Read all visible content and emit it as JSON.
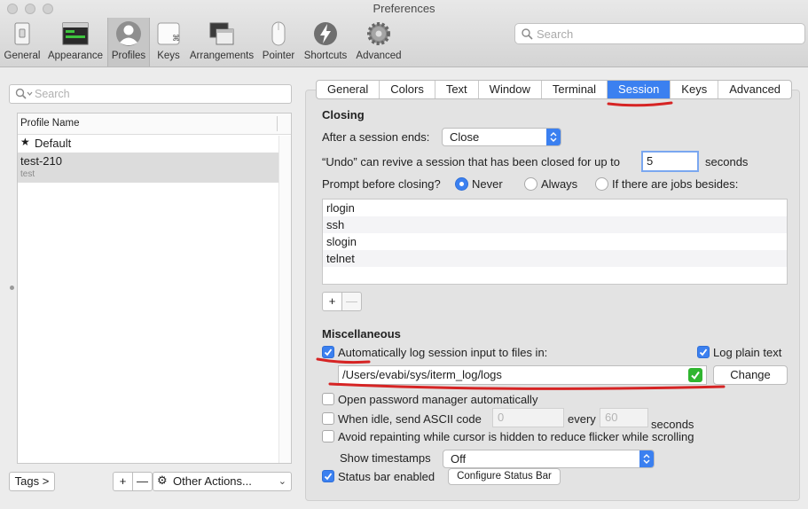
{
  "window": {
    "title": "Preferences"
  },
  "toolbar": {
    "items": [
      {
        "label": "General",
        "icon": "switch-icon"
      },
      {
        "label": "Appearance",
        "icon": "window-icon"
      },
      {
        "label": "Profiles",
        "icon": "user-icon",
        "selected": true
      },
      {
        "label": "Keys",
        "icon": "keyboard-icon"
      },
      {
        "label": "Arrangements",
        "icon": "windows-icon"
      },
      {
        "label": "Pointer",
        "icon": "mouse-icon"
      },
      {
        "label": "Shortcuts",
        "icon": "lightning-icon"
      },
      {
        "label": "Advanced",
        "icon": "gear-icon"
      }
    ],
    "search_placeholder": "Search"
  },
  "profiles": {
    "search_placeholder": "Search",
    "column_header": "Profile Name",
    "rows": [
      {
        "name": "Default",
        "default": true
      },
      {
        "name": "test-210",
        "subtitle": "test",
        "selected": true
      }
    ],
    "tags_button": "Tags >",
    "add_glyph": "+",
    "remove_glyph": "—",
    "other_actions": "Other Actions..."
  },
  "tabs": [
    {
      "label": "General"
    },
    {
      "label": "Colors"
    },
    {
      "label": "Text"
    },
    {
      "label": "Window"
    },
    {
      "label": "Terminal"
    },
    {
      "label": "Session",
      "active": true
    },
    {
      "label": "Keys"
    },
    {
      "label": "Advanced"
    }
  ],
  "closing": {
    "title": "Closing",
    "after_session_label": "After a session ends:",
    "after_session_value": "Close",
    "undo_label": "“Undo” can revive a session that has been closed for up to",
    "undo_value": "5",
    "undo_unit": "seconds",
    "prompt_label": "Prompt before closing?",
    "prompt_options": [
      "Never",
      "Always",
      "If there are jobs besides:"
    ],
    "prompt_selected": "Never",
    "jobs": [
      "rlogin",
      "ssh",
      "slogin",
      "telnet"
    ],
    "add_glyph": "+",
    "remove_glyph": "—"
  },
  "misc": {
    "title": "Miscellaneous",
    "auto_log_label": "Automatically log session input to files in:",
    "auto_log_checked": true,
    "log_plain_text_label": "Log plain text",
    "log_plain_text_checked": true,
    "log_path": "/Users/evabi/sys/iterm_log/logs",
    "change_button": "Change",
    "password_manager_label": "Open password manager automatically",
    "password_manager_checked": false,
    "idle_label": "When idle, send ASCII code",
    "idle_checked": false,
    "idle_code": "0",
    "every_label": "every",
    "idle_seconds": "60",
    "seconds_label": "seconds",
    "avoid_repaint_label": "Avoid repainting while cursor is hidden to reduce flicker while scrolling",
    "avoid_repaint_checked": false,
    "timestamps_label": "Show timestamps",
    "timestamps_value": "Off",
    "status_bar_label": "Status bar enabled",
    "status_bar_checked": true,
    "configure_status_bar": "Configure Status Bar"
  },
  "colors": {
    "accent": "#3b80f0",
    "annotation": "#d62424",
    "valid": "#2fb52f"
  }
}
